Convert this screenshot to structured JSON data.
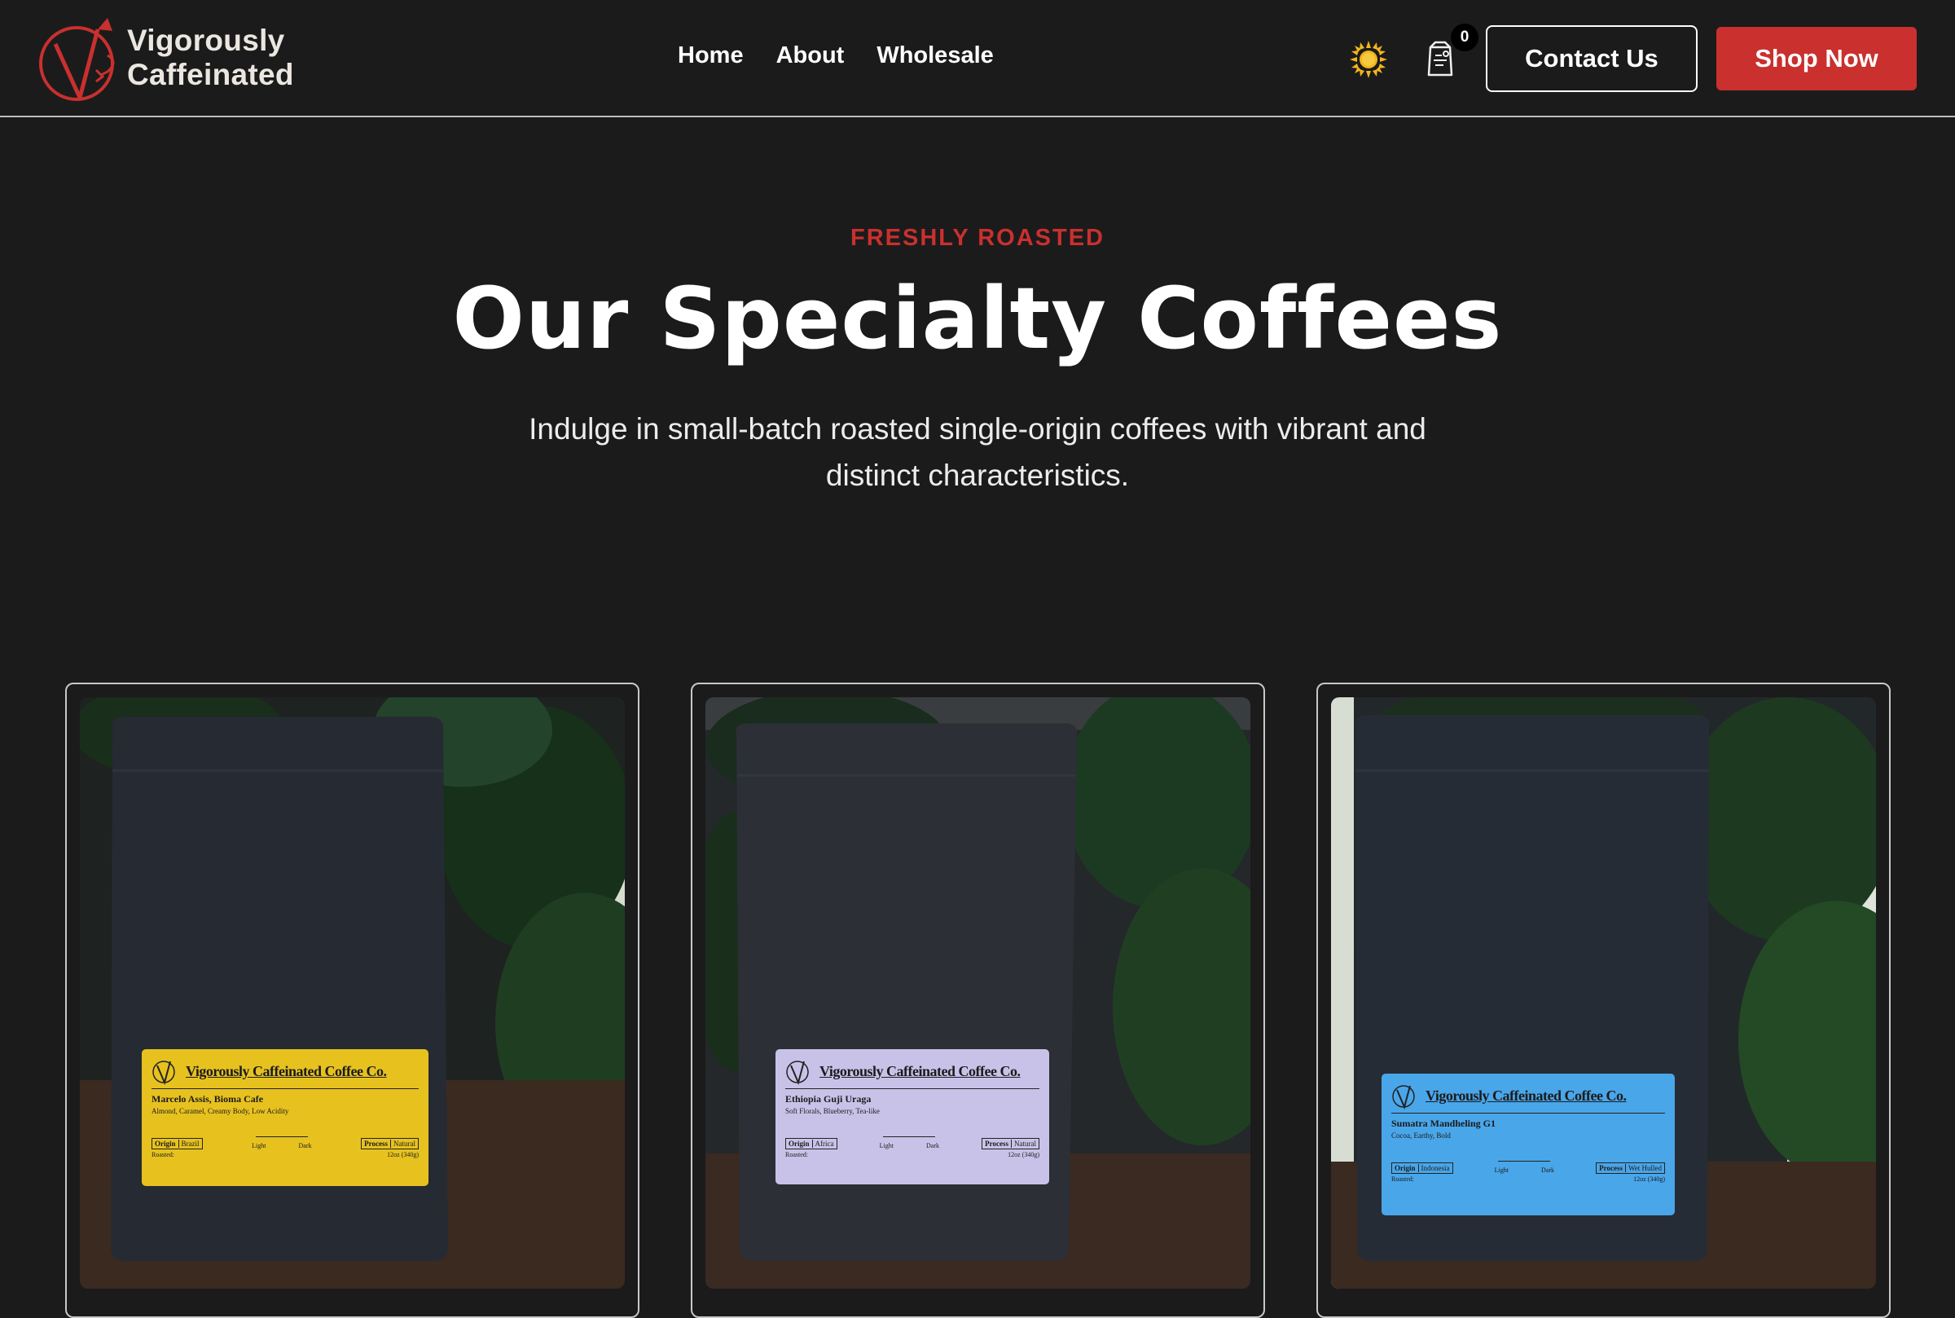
{
  "brand": {
    "line1": "Vigorously",
    "line2": "Caffeinated"
  },
  "nav": [
    {
      "label": "Home"
    },
    {
      "label": "About"
    },
    {
      "label": "Wholesale"
    }
  ],
  "header": {
    "theme_icon": "sun-icon",
    "cart_icon": "coffee-bag-cart-icon",
    "cart_count": "0",
    "contact_label": "Contact Us",
    "shop_label": "Shop Now"
  },
  "colors": {
    "accent": "#c9302e",
    "background": "#1b1b1c",
    "text": "#ffffff"
  },
  "hero": {
    "eyebrow": "FRESHLY ROASTED",
    "title": "Our Specialty Coffees",
    "subtitle": "Indulge in small-batch roasted single-origin coffees with vibrant and distinct characteristics."
  },
  "products": [
    {
      "label_color": "#e7c21f",
      "label_brand": "Vigorously Caffeinated Coffee Co.",
      "name": "Marcelo Assis, Bioma Cafe",
      "notes": "Almond, Caramel, Creamy Body, Low Acidity",
      "origin_key": "Origin",
      "origin": "Brazil",
      "process_key": "Process",
      "process": "Natural",
      "light": "Light",
      "dark": "Dark",
      "roasted": "Roasted:",
      "weight": "12oz (340g)"
    },
    {
      "label_color": "#c9c2e8",
      "label_brand": "Vigorously Caffeinated Coffee Co.",
      "name": "Ethiopia Guji Uraga",
      "notes": "Soft Florals, Blueberry, Tea-like",
      "origin_key": "Origin",
      "origin": "Africa",
      "process_key": "Process",
      "process": "Natural",
      "light": "Light",
      "dark": "Dark",
      "roasted": "Roasted:",
      "weight": "12oz (340g)"
    },
    {
      "label_color": "#49a6e9",
      "label_brand": "Vigorously Caffeinated Coffee Co.",
      "name": "Sumatra Mandheling G1",
      "notes": "Cocoa, Earthy, Bold",
      "origin_key": "Origin",
      "origin": "Indonesia",
      "process_key": "Process",
      "process": "Wet Hulled",
      "light": "Light",
      "dark": "Dark",
      "roasted": "Roasted:",
      "weight": "12oz (340g)"
    }
  ]
}
